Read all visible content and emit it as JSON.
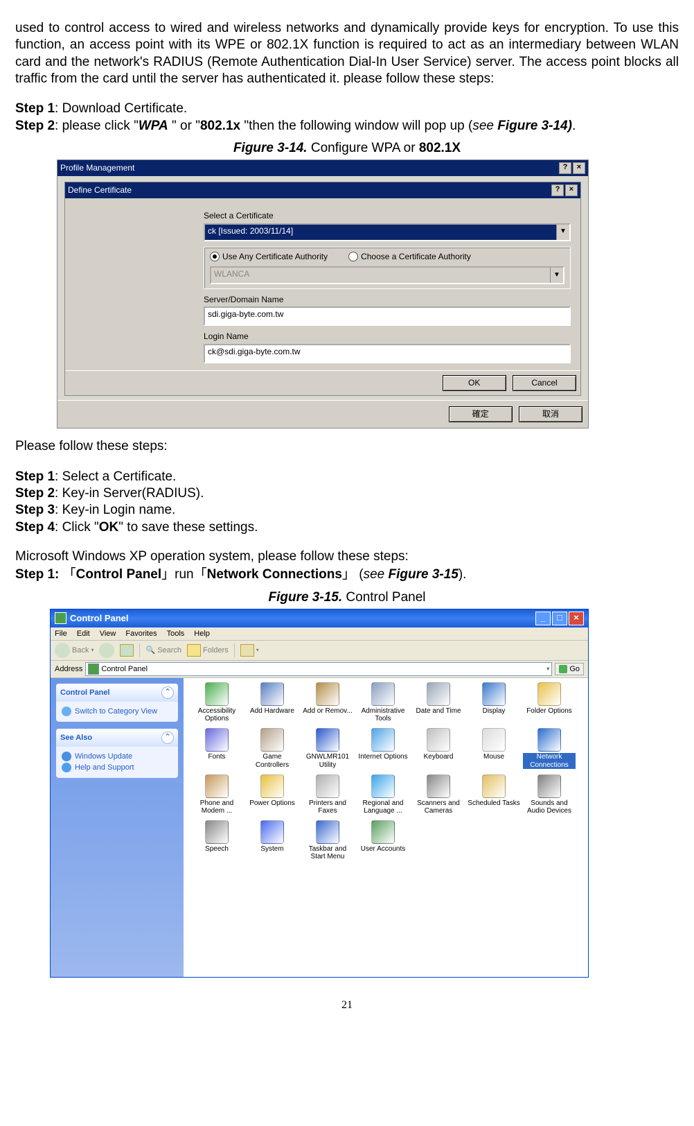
{
  "intro": "used to control access to wired and wireless networks and dynamically provide keys for encryption. To use this function, an access point with its WPE or 802.1X function is required to act as an intermediary between WLAN card and the network's RADIUS (Remote Authentication Dial-In User Service) server. The access point blocks all traffic from the card until the server has authenticated it. please follow these steps:",
  "step1a": ": Download Certificate.",
  "step2a_1": ": please click \"",
  "step2a_wpa": "WPA",
  "step2a_2": " \" or \"",
  "step2a_8021x": "802.1x",
  "step2a_3": " \"then the following window will pop up (",
  "step2a_see": "see ",
  "step2a_figref": "Figure 3-14)",
  "step2a_dot": ".",
  "fig314_label": "Figure 3-14.",
  "fig314_title": " Configure WPA or ",
  "fig314_8021x": "802.1X",
  "dlg_outer_title": "Profile Management",
  "dlg_inner_title": "Define Certificate",
  "lbl_select_cert": "Select a Certificate",
  "cert_value": "ck   [Issued: 2003/11/14]",
  "radio_any": "Use Any Certificate Authority",
  "radio_choose": "Choose a Certificate Authority",
  "ca_value": "WLANCA",
  "lbl_server": "Server/Domain Name",
  "server_value": "sdi.giga-byte.com.tw",
  "lbl_login": "Login Name",
  "login_value": "ck@sdi.giga-byte.com.tw",
  "btn_ok": "OK",
  "btn_cancel": "Cancel",
  "btn_confirm": "確定",
  "btn_cancel2": "取消",
  "please_follow": "Please follow these steps:",
  "b_step1": ": Select a Certificate.",
  "b_step2": ": Key-in Server(RADIUS).",
  "b_step3": ": Key-in Login name.",
  "b_step4_1": ": Click \"",
  "b_step4_ok": "OK",
  "b_step4_2": "\" to save these settings.",
  "xp_line": "Microsoft Windows XP operation system, please follow these steps:",
  "c_step1_1": "Step 1:",
  "c_step1_2": "  「",
  "c_step1_cp": "Control Panel",
  "c_step1_run": "」run「",
  "c_step1_nc": "Network Connections",
  "c_step1_close": "」",
  "c_step1_spc": "  (",
  "c_step1_see": "see ",
  "c_step1_figref": "Figure 3-15",
  "c_step1_end": ").",
  "fig315_label": "Figure 3-15.",
  "fig315_title": "    Control Panel",
  "cp": {
    "title": "Control Panel",
    "menu": [
      "File",
      "Edit",
      "View",
      "Favorites",
      "Tools",
      "Help"
    ],
    "back": "Back",
    "search": "Search",
    "folders": "Folders",
    "address_lbl": "Address",
    "address_val": "Control Panel",
    "go": "Go",
    "side1_title": "Control Panel",
    "side1_item": "Switch to Category View",
    "side2_title": "See Also",
    "side2_items": [
      "Windows Update",
      "Help and Support"
    ],
    "icons": [
      {
        "name": "Accessibility Options",
        "c": "#4caf50"
      },
      {
        "name": "Add Hardware",
        "c": "#5a7fc2"
      },
      {
        "name": "Add or Remov...",
        "c": "#b38f4a"
      },
      {
        "name": "Administrative Tools",
        "c": "#8aa0c2"
      },
      {
        "name": "Date and Time",
        "c": "#9aa7b8"
      },
      {
        "name": "Display",
        "c": "#3a78cc"
      },
      {
        "name": "Folder Options",
        "c": "#e6c14a"
      },
      {
        "name": "Fonts",
        "c": "#6a6ae0"
      },
      {
        "name": "Game Controllers",
        "c": "#b4a088"
      },
      {
        "name": "GNWLMR101 Utility",
        "c": "#2a5ad0"
      },
      {
        "name": "Internet Options",
        "c": "#4fa4e6"
      },
      {
        "name": "Keyboard",
        "c": "#c0c0c0"
      },
      {
        "name": "Mouse",
        "c": "#dcdcdc"
      },
      {
        "name": "Network Connections",
        "c": "#2a6ed0",
        "sel": true
      },
      {
        "name": "Phone and Modem ...",
        "c": "#c69a5a"
      },
      {
        "name": "Power Options",
        "c": "#e8c040"
      },
      {
        "name": "Printers and Faxes",
        "c": "#b0b0b0"
      },
      {
        "name": "Regional and Language ...",
        "c": "#3aa6e8"
      },
      {
        "name": "Scanners and Cameras",
        "c": "#888888"
      },
      {
        "name": "Scheduled Tasks",
        "c": "#e0c060"
      },
      {
        "name": "Sounds and Audio Devices",
        "c": "#808080"
      },
      {
        "name": "Speech",
        "c": "#888888"
      },
      {
        "name": "System",
        "c": "#4a6af0"
      },
      {
        "name": "Taskbar and Start Menu",
        "c": "#3a6ad0"
      },
      {
        "name": "User Accounts",
        "c": "#5aa060"
      }
    ]
  },
  "page_number": "21"
}
